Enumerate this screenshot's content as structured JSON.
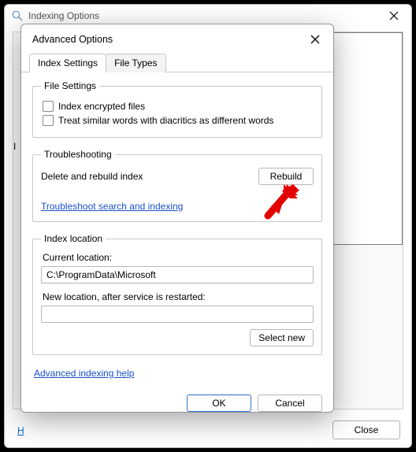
{
  "bg": {
    "title": "Indexing Options",
    "label": "I",
    "link": "H",
    "close_btn": "Close"
  },
  "dialog": {
    "title": "Advanced Options",
    "tabs": {
      "settings": "Index Settings",
      "filetypes": "File Types"
    },
    "file_settings": {
      "legend": "File Settings",
      "encrypted": "Index encrypted files",
      "diacritics": "Treat similar words with diacritics as different words"
    },
    "troubleshooting": {
      "legend": "Troubleshooting",
      "rebuild_label": "Delete and rebuild index",
      "rebuild_btn": "Rebuild",
      "ts_link": "Troubleshoot search and indexing"
    },
    "index_location": {
      "legend": "Index location",
      "current_label": "Current location:",
      "current_value": "C:\\ProgramData\\Microsoft",
      "new_label": "New location, after service is restarted:",
      "new_value": "",
      "select_btn": "Select new"
    },
    "help_link": "Advanced indexing help",
    "ok": "OK",
    "cancel": "Cancel"
  }
}
